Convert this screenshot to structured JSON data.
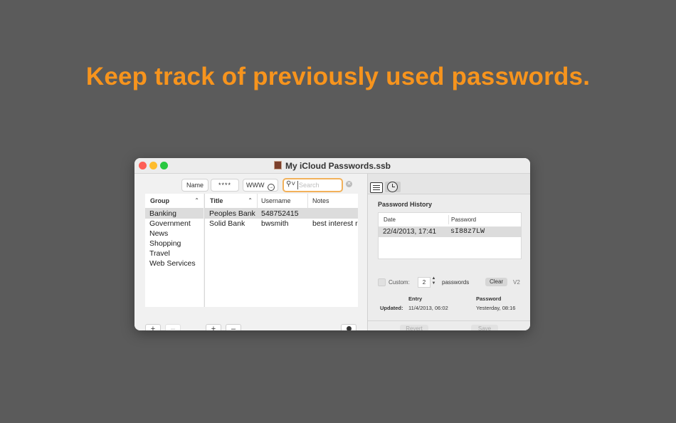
{
  "headline": "Keep track of previously used passwords.",
  "window": {
    "title": "My iCloud Passwords.ssb",
    "toolbar": {
      "name_label": "Name",
      "password_label": "****",
      "www_label": "WWW",
      "www_icon": "arrow-right-circle-icon",
      "search_placeholder": "Search",
      "search_value": ""
    },
    "groups": {
      "header": "Group",
      "items": [
        "Banking",
        "Government",
        "News",
        "Shopping",
        "Travel",
        "Web Services"
      ],
      "selected_index": 0
    },
    "entries": {
      "headers": {
        "title": "Title",
        "username": "Username",
        "notes": "Notes"
      },
      "rows": [
        {
          "title": "Peoples Bank",
          "username": "548752415",
          "notes": ""
        },
        {
          "title": "Solid Bank",
          "username": "bwsmith",
          "notes": "best interest r"
        }
      ],
      "selected_index": 0
    },
    "bottom_bar": {
      "add": "+",
      "remove_disabled": "–",
      "add2": "+",
      "remove": "–"
    },
    "history": {
      "section_title": "Password History",
      "headers": {
        "date": "Date",
        "password": "Password"
      },
      "rows": [
        {
          "date": "22/4/2013, 17:41",
          "password": "sI88z7LW"
        }
      ],
      "custom_label": "Custom:",
      "custom_value": "2",
      "passwords_label": "passwords",
      "clear_label": "Clear",
      "version": "V2",
      "entry_label": "Entry",
      "password_label": "Password",
      "updated_label": "Updated:",
      "entry_updated": "11/4/2013, 06:02",
      "password_updated": "Yesterday, 08:16",
      "revert_label": "Revert",
      "save_label": "Save"
    }
  },
  "colors": {
    "accent": "#f7941d",
    "background": "#5b5b5b",
    "selection": "#dcdcdc"
  }
}
